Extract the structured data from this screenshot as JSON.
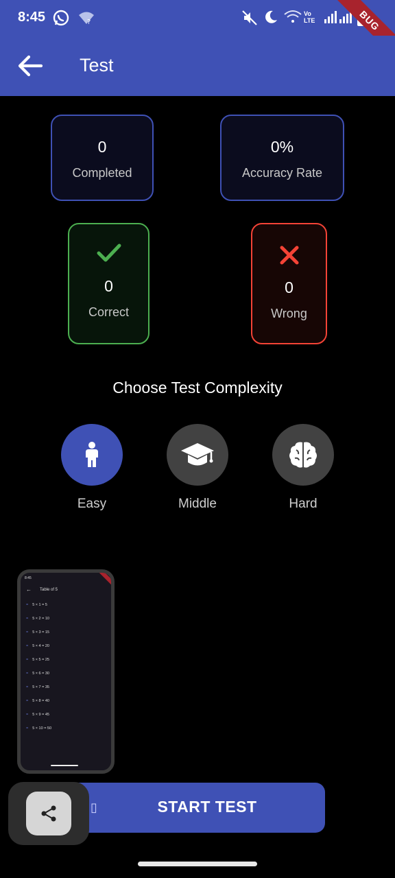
{
  "status_bar": {
    "time": "8:45",
    "network": "Vo LTE"
  },
  "debug_banner": "BUG",
  "app_bar": {
    "title": "Test"
  },
  "stats": {
    "completed": {
      "value": "0",
      "label": "Completed"
    },
    "accuracy": {
      "value": "0%",
      "label": "Accuracy Rate"
    },
    "correct": {
      "value": "0",
      "label": "Correct"
    },
    "wrong": {
      "value": "0",
      "label": "Wrong"
    }
  },
  "complexity": {
    "title": "Choose Test Complexity",
    "levels": [
      {
        "label": "Easy",
        "icon": "child-icon",
        "selected": true
      },
      {
        "label": "Middle",
        "icon": "graduation-cap-icon",
        "selected": false
      },
      {
        "label": "Hard",
        "icon": "brain-icon",
        "selected": false
      }
    ]
  },
  "preview": {
    "title": "Table of 5",
    "rows": [
      "5 × 1 = 5",
      "5 × 2 = 10",
      "5 × 3 = 15",
      "5 × 4 = 20",
      "5 × 5 = 25",
      "5 × 6 = 30",
      "5 × 7 = 35",
      "5 × 8 = 40",
      "5 × 9 = 45",
      "5 × 10 = 50"
    ]
  },
  "start_button": {
    "label": "START TEST",
    "glyph": "▯"
  },
  "colors": {
    "primary": "#3f51b5",
    "correct": "#4caf50",
    "wrong": "#f44336",
    "background": "#000000"
  }
}
